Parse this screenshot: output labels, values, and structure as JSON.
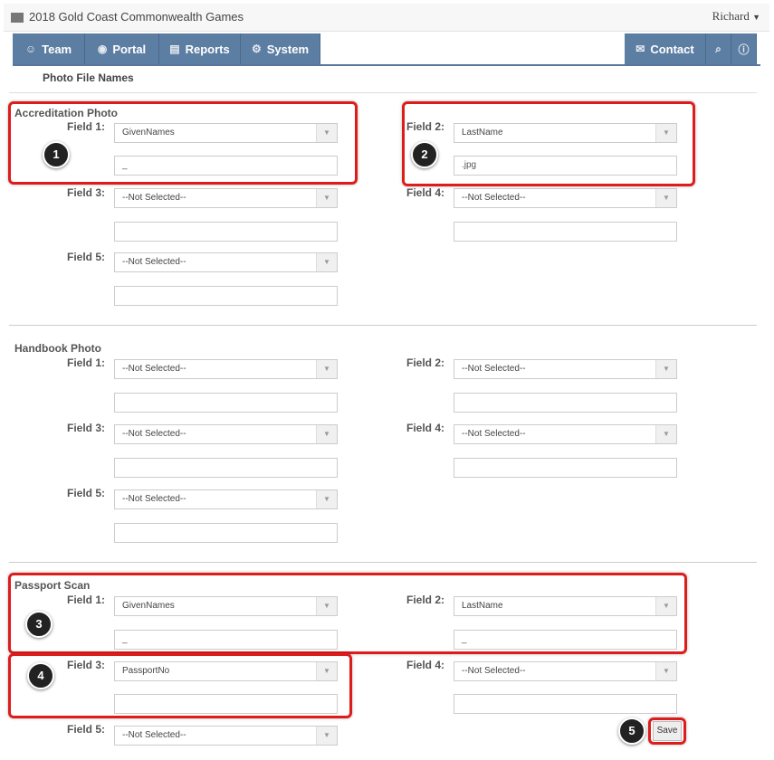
{
  "app": {
    "title": "2018 Gold Coast Commonwealth Games",
    "user": "Richard"
  },
  "nav": {
    "team": "Team",
    "portal": "Portal",
    "reports": "Reports",
    "system": "System",
    "contact": "Contact"
  },
  "icons": {
    "team": "group-icon",
    "portal": "globe-icon",
    "reports": "report-icon",
    "system": "gear-icon",
    "contact": "mail-icon",
    "search": "search-icon",
    "help": "help-icon",
    "user_menu": "caret-down-icon"
  },
  "page": {
    "section_tab": "Photo File Names"
  },
  "accreditation": {
    "title": "Accreditation Photo",
    "f1_label": "Field 1:",
    "f1_value": "GivenNames",
    "f1_text": "_",
    "f2_label": "Field 2:",
    "f2_value": "LastName",
    "f2_text": ".jpg",
    "f3_label": "Field 3:",
    "f3_value": "--Not Selected--",
    "f3_text": "",
    "f4_label": "Field 4:",
    "f4_value": "--Not Selected--",
    "f4_text": "",
    "f5_label": "Field 5:",
    "f5_value": "--Not Selected--",
    "f5_text": ""
  },
  "handbook": {
    "title": "Handbook Photo",
    "f1_label": "Field 1:",
    "f1_value": "--Not Selected--",
    "f2_label": "Field 2:",
    "f2_value": "--Not Selected--",
    "f3_label": "Field 3:",
    "f3_value": "--Not Selected--",
    "f4_label": "Field 4:",
    "f4_value": "--Not Selected--",
    "f5_label": "Field 5:",
    "f5_value": "--Not Selected--"
  },
  "passport": {
    "title": "Passport Scan",
    "f1_label": "Field 1:",
    "f1_value": "GivenNames",
    "f1_text": "_",
    "f2_label": "Field 2:",
    "f2_value": "LastName",
    "f2_text": "_",
    "f3_label": "Field 3:",
    "f3_value": "PassportNo",
    "f3_text": "",
    "f4_label": "Field 4:",
    "f4_value": "--Not Selected--",
    "f4_text": "",
    "f5_label": "Field 5:",
    "f5_value": "--Not Selected--"
  },
  "badges": {
    "b1": "1",
    "b2": "2",
    "b3": "3",
    "b4": "4",
    "b5": "5"
  },
  "save": "Save",
  "colors": {
    "nav": "#5d7ea3",
    "highlight": "#dd1c1c"
  }
}
